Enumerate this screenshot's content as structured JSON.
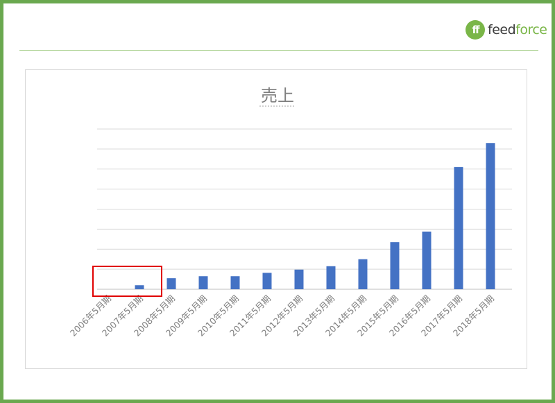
{
  "brand": {
    "logo_mark": "ff",
    "logo_text_a": "feed",
    "logo_text_b": "force",
    "accent_color": "#7ab648",
    "frame_color": "#6aa84f"
  },
  "chart_data": {
    "type": "bar",
    "title": "売上",
    "categories": [
      "2006年5月期",
      "2007年5月期",
      "2008年5月期",
      "2009年5月期",
      "2010年5月期",
      "2011年5月期",
      "2012年5月期",
      "2013年5月期",
      "2014年5月期",
      "2015年5月期",
      "2016年5月期",
      "2017年5月期",
      "2018年5月期"
    ],
    "series": [
      {
        "values": [
          0,
          2.0,
          5.5,
          6.5,
          6.5,
          8.2,
          9.8,
          11.5,
          15.0,
          23.5,
          28.8,
          61.0,
          73.0
        ]
      }
    ],
    "ylim": [
      0,
      80
    ],
    "gridlines": 8,
    "grid": true,
    "y_tick_labels_visible": false,
    "bar_color": "#4472c4",
    "highlight": {
      "categories": [
        "2006年5月期",
        "2007年5月期"
      ],
      "color": "#e00000"
    }
  }
}
